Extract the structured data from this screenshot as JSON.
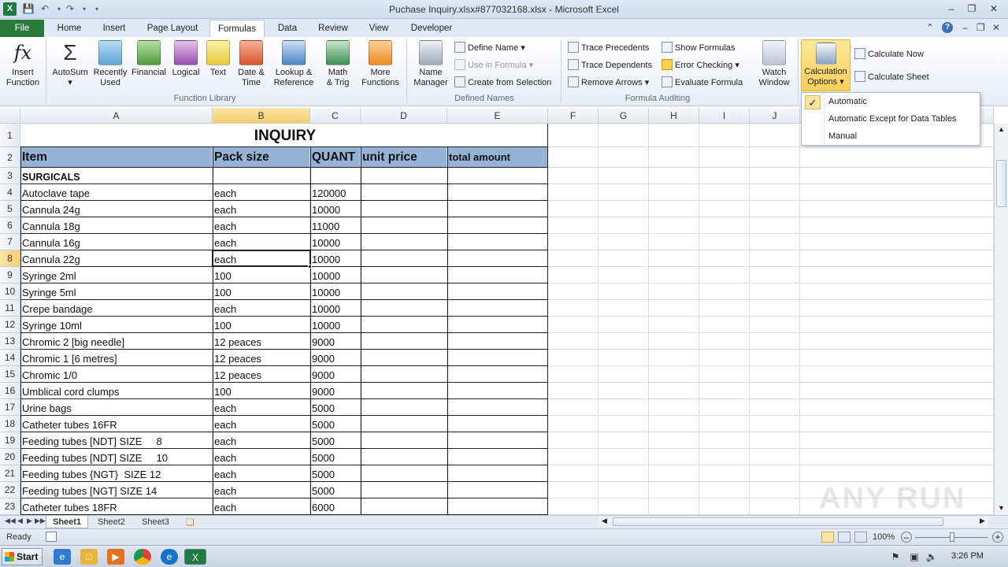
{
  "window": {
    "title": "Puchase Inquiry.xlsx#877032168.xlsx  -  Microsoft Excel",
    "app_icon_letter": "X"
  },
  "tabs": [
    "File",
    "Home",
    "Insert",
    "Page Layout",
    "Formulas",
    "Data",
    "Review",
    "View",
    "Developer"
  ],
  "active_tab": "Formulas",
  "ribbon": {
    "function_library": {
      "label": "Function Library",
      "insert_function": [
        "Insert",
        "Function"
      ],
      "autosum": "AutoSum",
      "recently_used": [
        "Recently",
        "Used"
      ],
      "financial": "Financial",
      "logical": "Logical",
      "text": "Text",
      "date_time": [
        "Date &",
        "Time"
      ],
      "lookup_reference": [
        "Lookup &",
        "Reference"
      ],
      "math_trig": [
        "Math",
        "& Trig"
      ],
      "more_functions": [
        "More",
        "Functions"
      ]
    },
    "defined_names": {
      "label": "Defined Names",
      "name_manager": [
        "Name",
        "Manager"
      ],
      "define_name": "Define Name",
      "use_in_formula": "Use in Formula",
      "create_from_selection": "Create from Selection"
    },
    "formula_auditing": {
      "label": "Formula Auditing",
      "trace_precedents": "Trace Precedents",
      "trace_dependents": "Trace Dependents",
      "remove_arrows": "Remove Arrows",
      "show_formulas": "Show Formulas",
      "error_checking": "Error Checking",
      "evaluate_formula": "Evaluate Formula",
      "watch_window": [
        "Watch",
        "Window"
      ]
    },
    "calculation": {
      "calculation_options": [
        "Calculation",
        "Options"
      ],
      "calculate_now": "Calculate Now",
      "calculate_sheet": "Calculate Sheet"
    }
  },
  "calc_menu": {
    "items": [
      "Automatic",
      "Automatic Except for Data Tables",
      "Manual"
    ],
    "checked": "Automatic"
  },
  "columns": [
    "A",
    "B",
    "C",
    "D",
    "E",
    "F",
    "G",
    "H",
    "I",
    "J"
  ],
  "selected_column": "B",
  "selected_row": "8",
  "sheet": {
    "title": "INQUIRY",
    "headers": [
      "Item",
      "Pack size",
      "QUANT",
      "unit price",
      "total amount"
    ],
    "rows": [
      [
        "SURGICALS",
        "",
        ""
      ],
      [
        "Autoclave tape",
        "each",
        "120000"
      ],
      [
        "Cannula 24g",
        "each",
        "10000"
      ],
      [
        "Cannula 18g",
        "each",
        "11000"
      ],
      [
        "Cannula 16g",
        "each",
        "10000"
      ],
      [
        "Cannula 22g",
        "each",
        "10000"
      ],
      [
        "Syringe 2ml",
        "100",
        "10000"
      ],
      [
        "Syringe 5ml",
        "100",
        "10000"
      ],
      [
        "Crepe bandage",
        "each",
        "10000"
      ],
      [
        "Syringe 10ml",
        "100",
        "10000"
      ],
      [
        "Chromic 2 [big needle]",
        "12 peaces",
        "9000"
      ],
      [
        "Chromic 1 [6 metres]",
        "12 peaces",
        "9000"
      ],
      [
        "Chromic 1/0",
        "12 peaces",
        "9000"
      ],
      [
        "Umblical cord clumps",
        "100",
        "9000"
      ],
      [
        "Urine bags",
        "each",
        "5000"
      ],
      [
        "Catheter tubes 16FR",
        "each",
        "5000"
      ],
      [
        "Feeding tubes [NDT] SIZE     8",
        "each",
        "5000"
      ],
      [
        "Feeding tubes [NDT] SIZE     10",
        "each",
        "5000"
      ],
      [
        "Feeding tubes {NGT}  SIZE 12",
        "each",
        "5000"
      ],
      [
        "Feeding tubes [NGT] SIZE 14",
        "each",
        "5000"
      ],
      [
        "Catheter tubes 18FR",
        "each",
        "6000"
      ]
    ]
  },
  "sheet_tabs": [
    "Sheet1",
    "Sheet2",
    "Sheet3"
  ],
  "active_sheet": "Sheet1",
  "status": {
    "ready": "Ready",
    "zoom": "100%"
  },
  "taskbar": {
    "start": "Start",
    "clock": "3:26 PM"
  },
  "watermark": "ANY RUN"
}
